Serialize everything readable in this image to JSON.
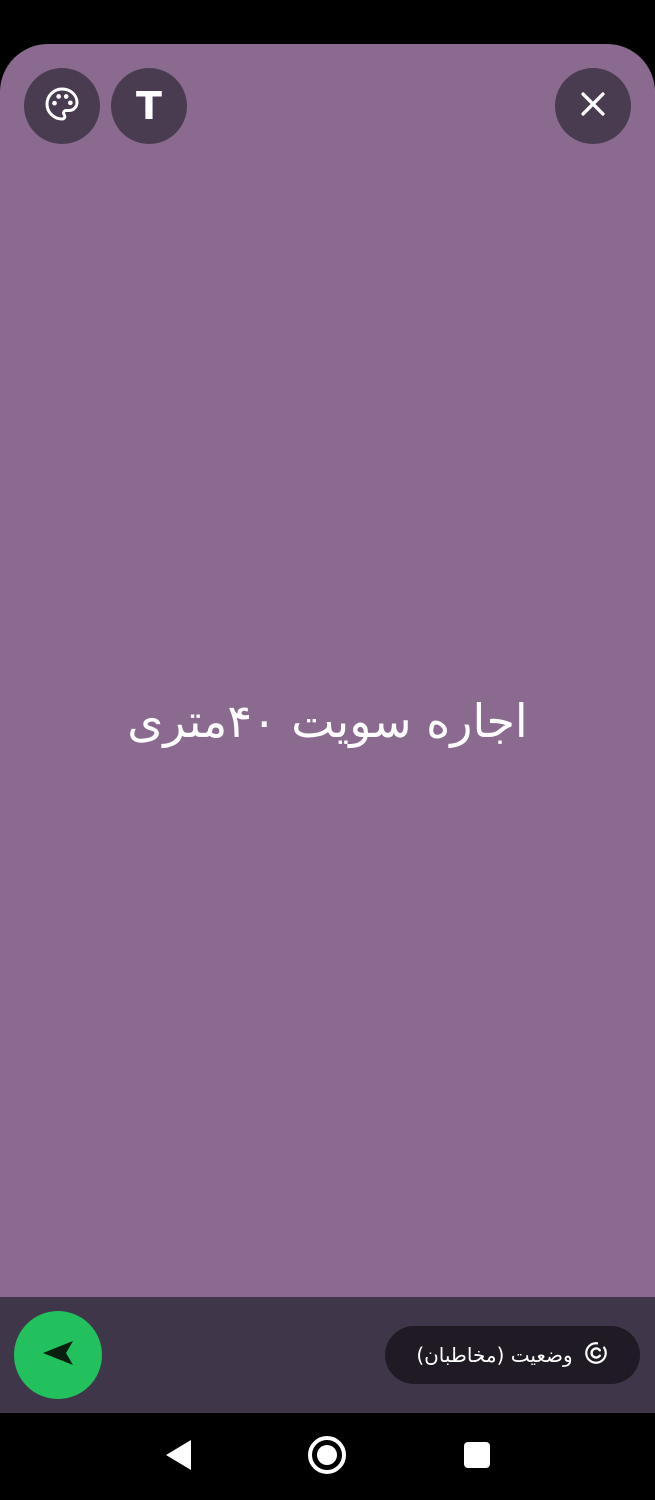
{
  "composer": {
    "background_color": "#8b6a90",
    "status_text": "اجاره سویت ۴۰متری"
  },
  "toolbar": {
    "palette_icon": "palette-icon",
    "text_icon": "text-format-icon",
    "text_glyph": "T",
    "close_icon": "close-icon"
  },
  "footer": {
    "privacy_label": "وضعیت (مخاطبان)",
    "privacy_icon": "status-privacy-icon",
    "send_icon": "send-icon",
    "send_color": "#22c15e"
  },
  "navigation": {
    "back_icon": "back-triangle-icon",
    "home_icon": "home-circle-icon",
    "recents_icon": "recents-square-icon"
  }
}
